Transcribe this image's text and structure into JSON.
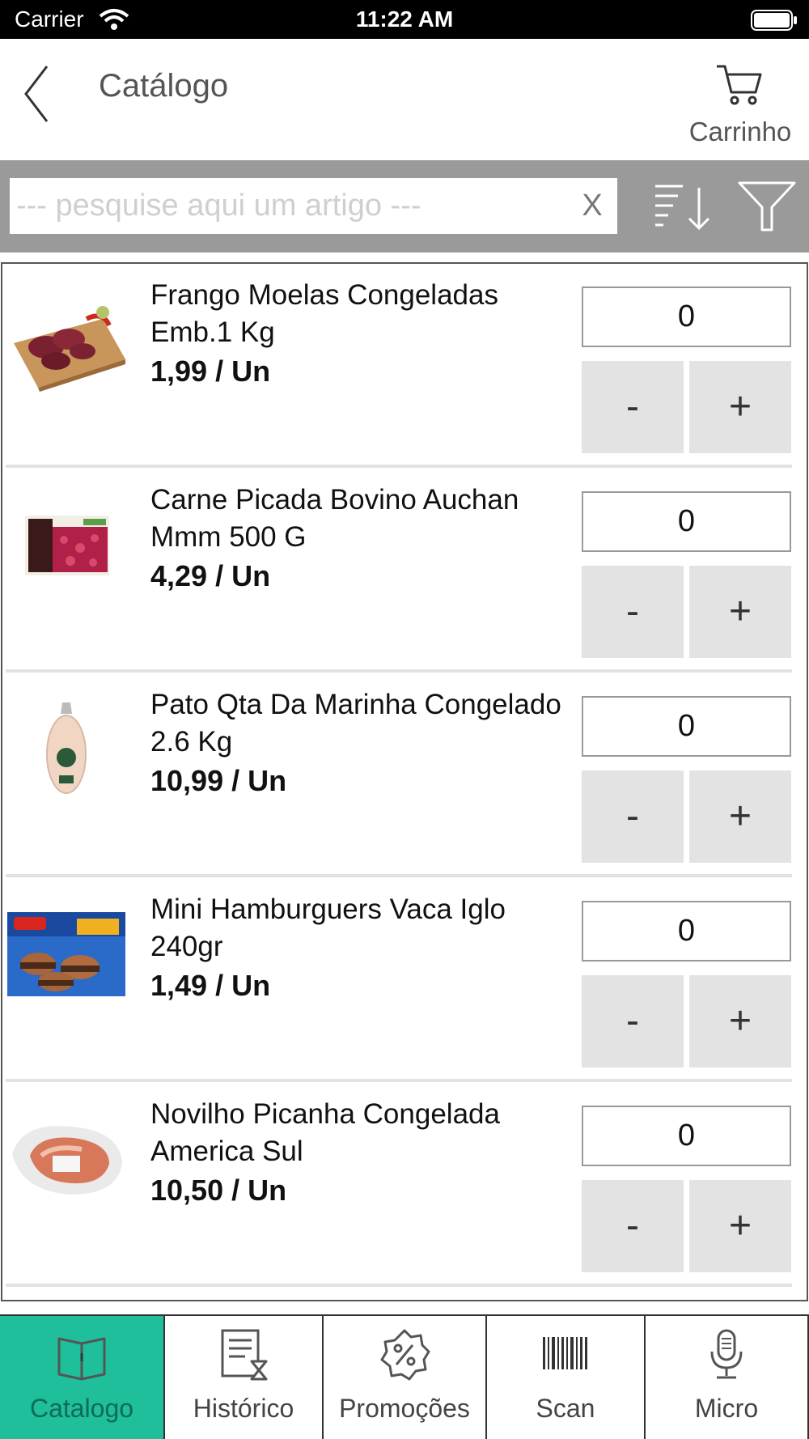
{
  "status_bar": {
    "carrier": "Carrier",
    "time": "11:22 AM"
  },
  "nav": {
    "title": "Catálogo",
    "cart_label": "Carrinho",
    "back_icon": "chevron-left-icon",
    "cart_icon": "cart-icon"
  },
  "search": {
    "placeholder": "--- pesquise aqui um artigo ---",
    "value": "",
    "clear_label": "X"
  },
  "products": [
    {
      "name": "Frango Moelas Congeladas Emb.1 Kg",
      "price": "1,99  / Un",
      "qty": "0",
      "minus": "-",
      "plus": "+"
    },
    {
      "name": "Carne Picada Bovino Auchan Mmm 500 G",
      "price": "4,29  / Un",
      "qty": "0",
      "minus": "-",
      "plus": "+"
    },
    {
      "name": "Pato Qta Da Marinha Congelado 2.6 Kg",
      "price": "10,99  / Un",
      "qty": "0",
      "minus": "-",
      "plus": "+"
    },
    {
      "name": "Mini Hamburguers Vaca Iglo 240gr",
      "price": "1,49  / Un",
      "qty": "0",
      "minus": "-",
      "plus": "+"
    },
    {
      "name": "Novilho Picanha Congelada America Sul",
      "price": "10,50  / Un",
      "qty": "0",
      "minus": "-",
      "plus": "+"
    }
  ],
  "tabs": [
    {
      "label": "Catalogo",
      "icon": "book-icon",
      "active": true
    },
    {
      "label": "Histórico",
      "icon": "history-icon",
      "active": false
    },
    {
      "label": "Promoções",
      "icon": "percent-badge-icon",
      "active": false
    },
    {
      "label": "Scan",
      "icon": "barcode-icon",
      "active": false
    },
    {
      "label": "Micro",
      "icon": "microphone-icon",
      "active": false
    }
  ],
  "colors": {
    "active_tab": "#1fbf9c",
    "search_strip": "#9a9a9a",
    "stepper_bg": "#e3e3e3"
  }
}
